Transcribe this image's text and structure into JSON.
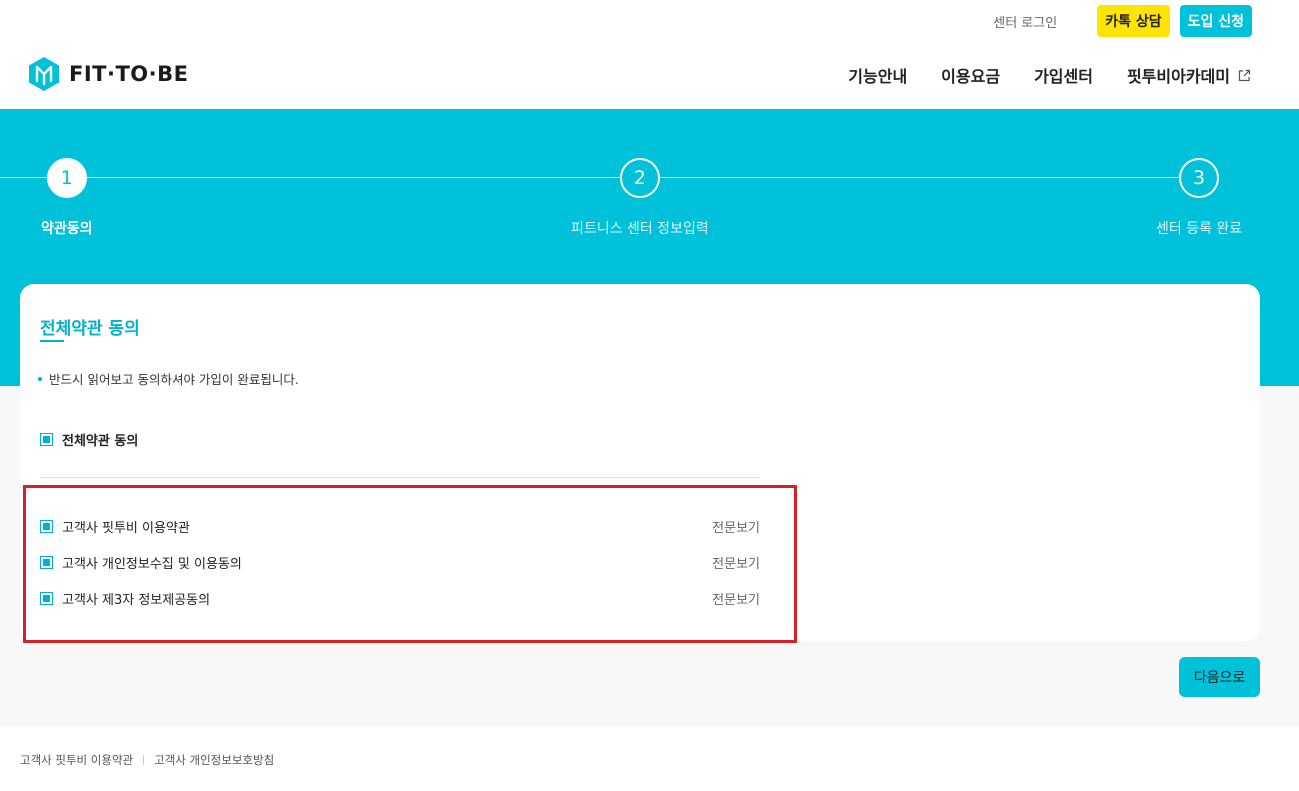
{
  "header": {
    "center_login": "센터 로그인",
    "kakao_button": "카톡 상담",
    "intro_button": "도입 신청",
    "logo_text": "FIT·TO·BE",
    "nav": [
      {
        "label": "기능안내"
      },
      {
        "label": "이용요금"
      },
      {
        "label": "가입센터"
      },
      {
        "label": "핏투비아카데미"
      }
    ]
  },
  "stepper": {
    "steps": [
      {
        "number": "1",
        "label": "약관동의",
        "active": true
      },
      {
        "number": "2",
        "label": "피트니스 센터 정보입력",
        "active": false
      },
      {
        "number": "3",
        "label": "센터 등록 완료",
        "active": false
      }
    ]
  },
  "card": {
    "title": "전체약관 동의",
    "notice": "반드시 읽어보고 동의하셔야 가입이 완료됩니다.",
    "agree_all_label": "전체약관 동의",
    "terms": [
      {
        "label": "고객사 핏투비 이용약관",
        "view": "전문보기"
      },
      {
        "label": "고객사 개인정보수집 및 이용동의",
        "view": "전문보기"
      },
      {
        "label": "고객사 제3자 정보제공동의",
        "view": "전문보기"
      }
    ]
  },
  "next_button": "다음으로",
  "footer": {
    "links": [
      {
        "label": "고객사 핏투비 이용약관"
      },
      {
        "label": "고객사 개인정보보호방침"
      }
    ]
  },
  "colors": {
    "brand": "#00c1da",
    "kakao": "#fee500",
    "highlight": "#d61f26"
  }
}
